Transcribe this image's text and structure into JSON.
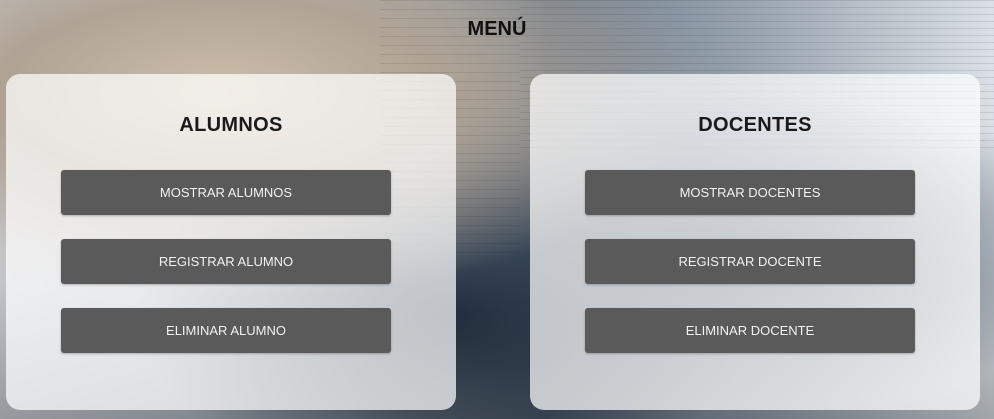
{
  "header": {
    "title": "MENÚ"
  },
  "alumnos_panel": {
    "heading": "ALUMNOS",
    "buttons": [
      {
        "label": "MOSTRAR ALUMNOS"
      },
      {
        "label": "REGISTRAR ALUMNO"
      },
      {
        "label": "ELIMINAR ALUMNO"
      }
    ]
  },
  "docentes_panel": {
    "heading": "DOCENTES",
    "buttons": [
      {
        "label": "MOSTRAR DOCENTES"
      },
      {
        "label": "REGISTRAR DOCENTE"
      },
      {
        "label": "ELIMINAR DOCENTE"
      }
    ]
  },
  "colors": {
    "button_bg": "#5a5a5a",
    "button_text": "#f2f2f2",
    "panel_bg": "rgba(255,255,255,0.72)"
  }
}
